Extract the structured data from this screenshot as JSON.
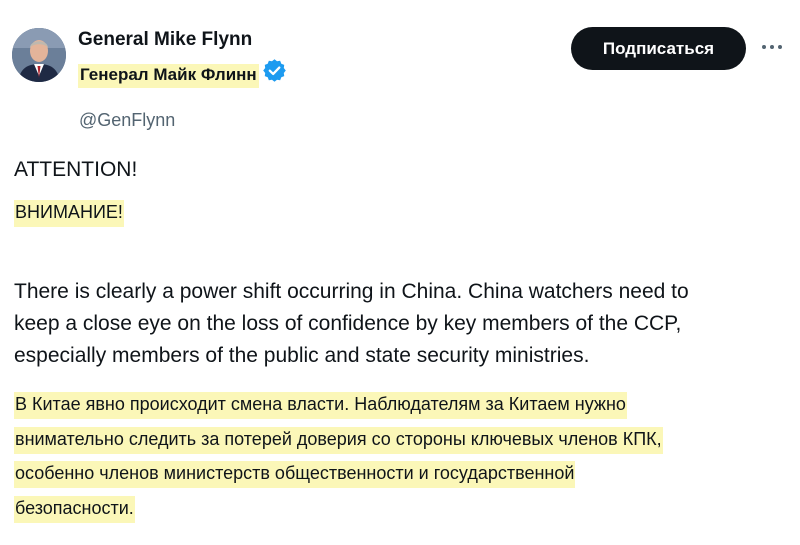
{
  "author": {
    "name_en": "General Mike Flynn",
    "name_ru": "Генерал Майк Флинн",
    "handle": "@GenFlynn",
    "verified": true,
    "avatar_icon": "avatar-photo",
    "badge_icon": "verified-badge-icon",
    "badge_color": "#1d9bf0"
  },
  "actions": {
    "follow_label": "Подписаться",
    "more_icon": "more-options-icon"
  },
  "post": {
    "heading_en": "ATTENTION!",
    "heading_ru": "ВНИМАНИЕ!",
    "body_en_lines": [
      "There is clearly a power shift occurring in China. China watchers need to",
      "keep a close eye on the loss of confidence by key members of the CCP,",
      "especially members of the public and state security ministries."
    ],
    "body_ru_lines": [
      "В Китае явно происходит смена власти. Наблюдателям за Китаем нужно",
      "внимательно следить за потерей доверия со стороны ключевых членов КПК,",
      "особенно членов министерств общественности и государственной",
      "безопасности."
    ]
  },
  "colors": {
    "translation_highlight": "#fbf7b8",
    "text_primary": "#0f1419",
    "text_secondary": "#536471",
    "button_bg": "#0f1419"
  }
}
